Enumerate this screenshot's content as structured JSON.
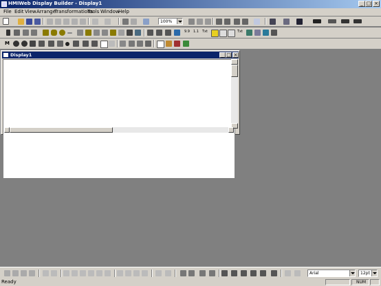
{
  "window": {
    "title": "HMIWeb Display Builder - Display1"
  },
  "menu": [
    "File",
    "Edit",
    "View",
    "Arrange",
    "Transformations",
    "Tools",
    "Window",
    "Help"
  ],
  "toolbar": {
    "zoom": "100%"
  },
  "child_window": {
    "title": "Display1"
  },
  "font_bar": {
    "font": "Arial",
    "size": "12pt"
  },
  "status": {
    "ready": "Ready",
    "num": "NUM"
  }
}
